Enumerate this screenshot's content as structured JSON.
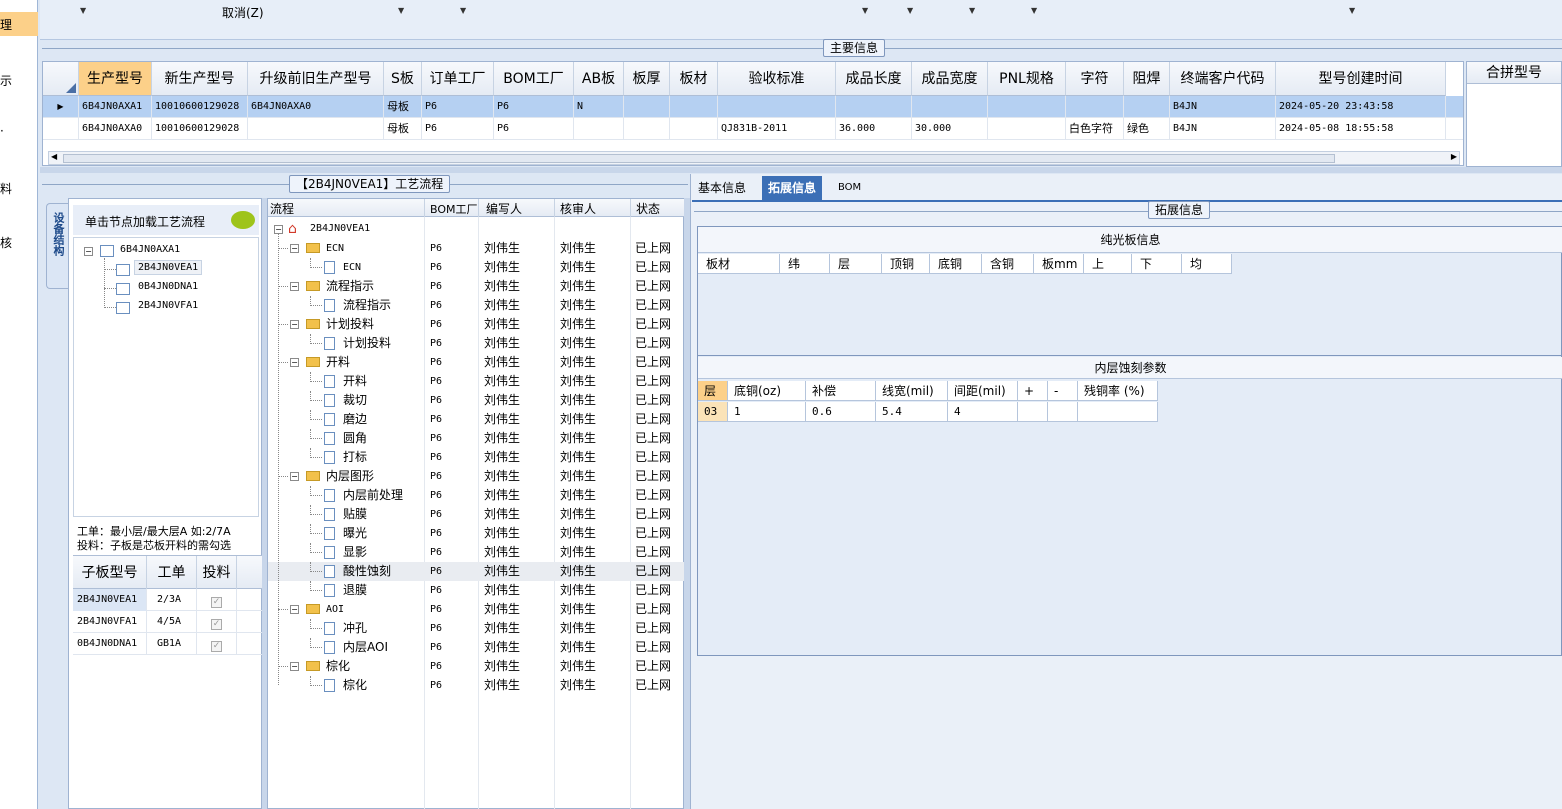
{
  "left_strip": {
    "items": [
      "理",
      "示",
      "·",
      "料",
      "核"
    ]
  },
  "toolbar": {
    "partial_text": "取消(Z)"
  },
  "main_info": {
    "title": "主要信息",
    "columns": [
      "生产型号",
      "新生产型号",
      "升级前旧生产型号",
      "S板",
      "订单工厂",
      "BOM工厂",
      "AB板",
      "板厚",
      "板材",
      "验收标准",
      "成品长度",
      "成品宽度",
      "PNL规格",
      "字符",
      "阻焊",
      "终端客户代码",
      "型号创建时间"
    ],
    "rows": [
      [
        "6B4JN0AXA1",
        "10010600129028",
        "6B4JN0AXA0",
        "母板",
        "P6",
        "P6",
        "N",
        "",
        "",
        "",
        "",
        "",
        "",
        "",
        "",
        "B4JN",
        "2024-05-20 23:43:58"
      ],
      [
        "6B4JN0AXA0",
        "10010600129028",
        "",
        "母板",
        "P6",
        "P6",
        "",
        "",
        "",
        "QJ831B-2011",
        "36.000",
        "30.000",
        "",
        "白色字符",
        "绿色",
        "B4JN",
        "2024-05-08 18:55:58"
      ]
    ],
    "merge_header": "合拼型号"
  },
  "process": {
    "title": "【2B4JN0VEA1】工艺流程"
  },
  "structure": {
    "vtab": "设备结构",
    "hint_title": "单击节点加载工艺流程",
    "tree": {
      "root": "6B4JN0AXA1",
      "children": [
        "2B4JN0VEA1",
        "0B4JN0DNA1",
        "2B4JN0VFA1"
      ]
    },
    "note1": "工单：最小层/最大层A 如:2/7A",
    "note2": "投料：子板是芯板开料的需勾选",
    "sub_columns": [
      "子板型号",
      "工单",
      "投料"
    ],
    "sub_rows": [
      [
        "2B4JN0VEA1",
        "2/3A"
      ],
      [
        "2B4JN0VFA1",
        "4/5A"
      ],
      [
        "0B4JN0DNA1",
        "GB1A"
      ]
    ]
  },
  "flow": {
    "columns": [
      "流程",
      "BOM工厂",
      "编写人",
      "核审人",
      "状态"
    ],
    "root": "2B4JN0VEA1",
    "rows": [
      {
        "name": "ECN",
        "lvl": 1
      },
      {
        "name": "ECN",
        "lvl": 2
      },
      {
        "name": "流程指示",
        "lvl": 1
      },
      {
        "name": "流程指示",
        "lvl": 2
      },
      {
        "name": "计划投料",
        "lvl": 1
      },
      {
        "name": "计划投料",
        "lvl": 2
      },
      {
        "name": "开料",
        "lvl": 1
      },
      {
        "name": "开料",
        "lvl": 2
      },
      {
        "name": "裁切",
        "lvl": 2
      },
      {
        "name": "磨边",
        "lvl": 2
      },
      {
        "name": "圆角",
        "lvl": 2
      },
      {
        "name": "打标",
        "lvl": 2
      },
      {
        "name": "内层图形",
        "lvl": 1
      },
      {
        "name": "内层前处理",
        "lvl": 2
      },
      {
        "name": "贴膜",
        "lvl": 2
      },
      {
        "name": "曝光",
        "lvl": 2
      },
      {
        "name": "显影",
        "lvl": 2
      },
      {
        "name": "酸性蚀刻",
        "lvl": 2
      },
      {
        "name": "退膜",
        "lvl": 2
      },
      {
        "name": "AOI",
        "lvl": 1
      },
      {
        "name": "冲孔",
        "lvl": 2
      },
      {
        "name": "内层AOI",
        "lvl": 2
      },
      {
        "name": "棕化",
        "lvl": 1
      },
      {
        "name": "棕化",
        "lvl": 2
      }
    ],
    "bom": "P6",
    "writer": "刘伟生",
    "reviewer": "刘伟生",
    "status": "已上网"
  },
  "tabs": [
    "基本信息",
    "拓展信息",
    "BOM"
  ],
  "ext": {
    "title": "拓展信息",
    "plain_board": {
      "title": "纯光板信息",
      "columns": [
        "板材",
        "纬",
        "层",
        "顶铜",
        "底铜",
        "含铜",
        "板mm",
        "上",
        "下",
        "均"
      ]
    },
    "inner_etch": {
      "title": "内层蚀刻参数",
      "columns": [
        "层",
        "底铜(oz)",
        "补偿",
        "线宽(mil)",
        "间距(mil)",
        "+",
        "-",
        "残铜率 (%)"
      ],
      "row": [
        "03",
        "1",
        "0.6",
        "5.4",
        "4",
        "",
        "",
        ""
      ]
    }
  }
}
